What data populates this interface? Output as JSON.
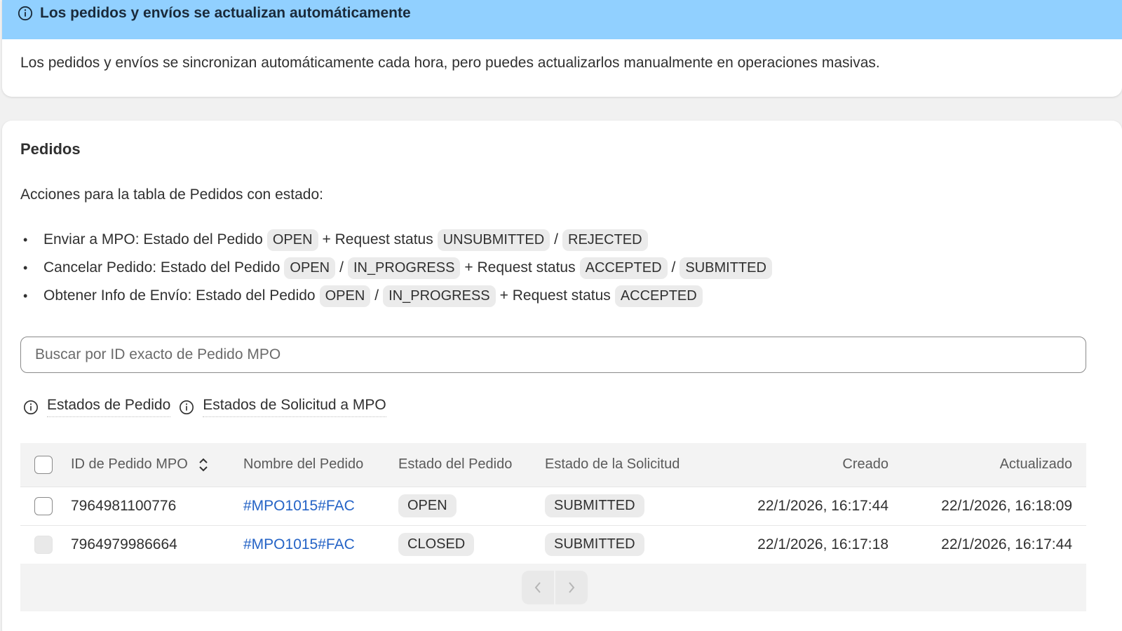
{
  "banner": {
    "title": "Los pedidos y envíos se actualizan automáticamente",
    "body": "Los pedidos y envíos se sincronizan automáticamente cada hora, pero puedes actualizarlos manualmente en operaciones masivas."
  },
  "orders": {
    "title": "Pedidos",
    "subtitle": "Acciones para la tabla de Pedidos con estado:",
    "rules": [
      {
        "lead": "Enviar a MPO: Estado del Pedido",
        "order_states": [
          "OPEN"
        ],
        "request_label": "+ Request status",
        "request_states": [
          "UNSUBMITTED",
          "REJECTED"
        ]
      },
      {
        "lead": "Cancelar Pedido: Estado del Pedido",
        "order_states": [
          "OPEN",
          "IN_PROGRESS"
        ],
        "request_label": "+ Request status",
        "request_states": [
          "ACCEPTED",
          "SUBMITTED"
        ]
      },
      {
        "lead": "Obtener Info de Envío: Estado del Pedido",
        "order_states": [
          "OPEN",
          "IN_PROGRESS"
        ],
        "request_label": "+ Request status",
        "request_states": [
          "ACCEPTED"
        ]
      }
    ],
    "separator": "/",
    "search_placeholder": "Buscar por ID exacto de Pedido MPO",
    "legend_links": [
      "Estados de Pedido",
      "Estados de Solicitud a MPO"
    ],
    "table": {
      "columns": [
        "ID de Pedido MPO",
        "Nombre del Pedido",
        "Estado del Pedido",
        "Estado de la Solicitud",
        "Creado",
        "Actualizado"
      ],
      "rows": [
        {
          "id": "7964981100776",
          "name": "#MPO1015#FAC",
          "order_state": "OPEN",
          "request_state": "SUBMITTED",
          "created": "22/1/2026, 16:17:44",
          "updated": "22/1/2026, 16:18:09",
          "selectable": true
        },
        {
          "id": "7964979986664",
          "name": "#MPO1015#FAC",
          "order_state": "CLOSED",
          "request_state": "SUBMITTED",
          "created": "22/1/2026, 16:17:18",
          "updated": "22/1/2026, 16:17:44",
          "selectable": false
        }
      ]
    },
    "pagination": {
      "prev_icon": "chevron-left-icon",
      "next_icon": "chevron-right-icon"
    }
  },
  "colors": {
    "banner_bg": "#91d0ff",
    "link": "#2463c6",
    "chip_bg": "#ebebeb",
    "page_bg": "#f1f1f1"
  }
}
